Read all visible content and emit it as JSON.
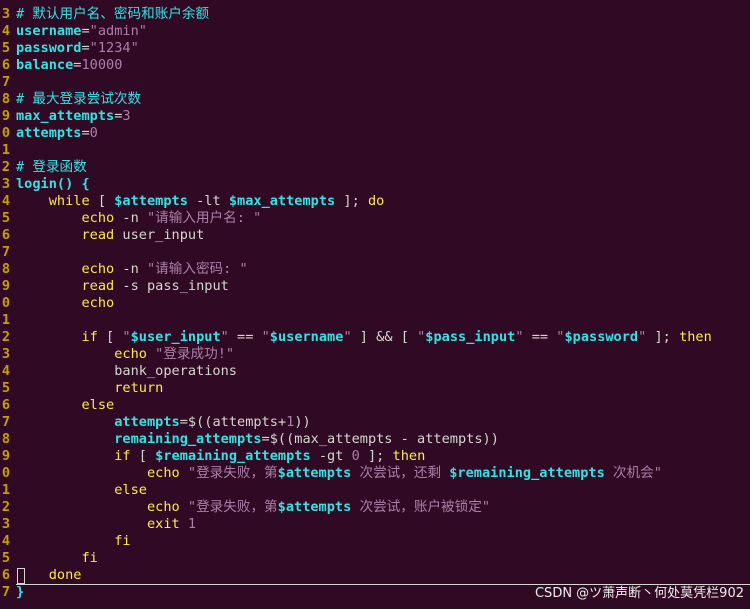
{
  "editor": {
    "lines": [
      {
        "num": "3",
        "parts": [
          {
            "c": "cmt",
            "t": "# 默认用户名、密码和账户余额"
          }
        ]
      },
      {
        "num": "4",
        "parts": [
          {
            "c": "var",
            "t": "username"
          },
          {
            "c": "plain",
            "t": "="
          },
          {
            "c": "str",
            "t": "\"admin\""
          }
        ]
      },
      {
        "num": "5",
        "parts": [
          {
            "c": "var",
            "t": "password"
          },
          {
            "c": "plain",
            "t": "="
          },
          {
            "c": "str",
            "t": "\"1234\""
          }
        ]
      },
      {
        "num": "6",
        "parts": [
          {
            "c": "var",
            "t": "balance"
          },
          {
            "c": "plain",
            "t": "="
          },
          {
            "c": "num",
            "t": "10000"
          }
        ]
      },
      {
        "num": "7",
        "parts": []
      },
      {
        "num": "8",
        "parts": [
          {
            "c": "cmt",
            "t": "# 最大登录尝试次数"
          }
        ]
      },
      {
        "num": "9",
        "parts": [
          {
            "c": "var",
            "t": "max_attempts"
          },
          {
            "c": "plain",
            "t": "="
          },
          {
            "c": "num",
            "t": "3"
          }
        ]
      },
      {
        "num": "0",
        "parts": [
          {
            "c": "var",
            "t": "attempts"
          },
          {
            "c": "plain",
            "t": "="
          },
          {
            "c": "num",
            "t": "0"
          }
        ]
      },
      {
        "num": "1",
        "parts": []
      },
      {
        "num": "2",
        "parts": [
          {
            "c": "cmt",
            "t": "# 登录函数"
          }
        ]
      },
      {
        "num": "3",
        "parts": [
          {
            "c": "fn",
            "t": "login() {"
          }
        ]
      },
      {
        "num": "4",
        "parts": [
          {
            "c": "plain",
            "t": "    "
          },
          {
            "c": "kw",
            "t": "while"
          },
          {
            "c": "plain",
            "t": " [ "
          },
          {
            "c": "var",
            "t": "$attempts"
          },
          {
            "c": "plain",
            "t": " -lt "
          },
          {
            "c": "var",
            "t": "$max_attempts"
          },
          {
            "c": "plain",
            "t": " ]; "
          },
          {
            "c": "kw",
            "t": "do"
          }
        ]
      },
      {
        "num": "5",
        "parts": [
          {
            "c": "plain",
            "t": "        "
          },
          {
            "c": "kw",
            "t": "echo"
          },
          {
            "c": "plain",
            "t": " -n "
          },
          {
            "c": "str",
            "t": "\"请输入用户名: \""
          }
        ]
      },
      {
        "num": "6",
        "parts": [
          {
            "c": "plain",
            "t": "        "
          },
          {
            "c": "kw",
            "t": "read"
          },
          {
            "c": "plain",
            "t": " user_input"
          }
        ]
      },
      {
        "num": "7",
        "parts": []
      },
      {
        "num": "8",
        "parts": [
          {
            "c": "plain",
            "t": "        "
          },
          {
            "c": "kw",
            "t": "echo"
          },
          {
            "c": "plain",
            "t": " -n "
          },
          {
            "c": "str",
            "t": "\"请输入密码: \""
          }
        ]
      },
      {
        "num": "9",
        "parts": [
          {
            "c": "plain",
            "t": "        "
          },
          {
            "c": "kw",
            "t": "read"
          },
          {
            "c": "plain",
            "t": " -s pass_input"
          }
        ]
      },
      {
        "num": "0",
        "parts": [
          {
            "c": "plain",
            "t": "        "
          },
          {
            "c": "kw",
            "t": "echo"
          }
        ]
      },
      {
        "num": "1",
        "parts": []
      },
      {
        "num": "2",
        "parts": [
          {
            "c": "plain",
            "t": "        "
          },
          {
            "c": "kw",
            "t": "if"
          },
          {
            "c": "plain",
            "t": " [ "
          },
          {
            "c": "str",
            "t": "\""
          },
          {
            "c": "var",
            "t": "$user_input"
          },
          {
            "c": "str",
            "t": "\""
          },
          {
            "c": "plain",
            "t": " == "
          },
          {
            "c": "str",
            "t": "\""
          },
          {
            "c": "var",
            "t": "$username"
          },
          {
            "c": "str",
            "t": "\""
          },
          {
            "c": "plain",
            "t": " ] && [ "
          },
          {
            "c": "str",
            "t": "\""
          },
          {
            "c": "var",
            "t": "$pass_input"
          },
          {
            "c": "str",
            "t": "\""
          },
          {
            "c": "plain",
            "t": " == "
          },
          {
            "c": "str",
            "t": "\""
          },
          {
            "c": "var",
            "t": "$password"
          },
          {
            "c": "str",
            "t": "\""
          },
          {
            "c": "plain",
            "t": " ]; "
          },
          {
            "c": "kw",
            "t": "then"
          }
        ]
      },
      {
        "num": "3",
        "parts": [
          {
            "c": "plain",
            "t": "            "
          },
          {
            "c": "kw",
            "t": "echo"
          },
          {
            "c": "plain",
            "t": " "
          },
          {
            "c": "str",
            "t": "\"登录成功!\""
          }
        ]
      },
      {
        "num": "4",
        "parts": [
          {
            "c": "plain",
            "t": "            bank_operations"
          }
        ]
      },
      {
        "num": "5",
        "parts": [
          {
            "c": "plain",
            "t": "            "
          },
          {
            "c": "kw",
            "t": "return"
          }
        ]
      },
      {
        "num": "6",
        "parts": [
          {
            "c": "plain",
            "t": "        "
          },
          {
            "c": "kw",
            "t": "else"
          }
        ]
      },
      {
        "num": "7",
        "parts": [
          {
            "c": "plain",
            "t": "            "
          },
          {
            "c": "var",
            "t": "attempts"
          },
          {
            "c": "plain",
            "t": "=$(("
          },
          {
            "c": "plain",
            "t": "attempts"
          },
          {
            "c": "plain",
            "t": "+"
          },
          {
            "c": "num",
            "t": "1"
          },
          {
            "c": "plain",
            "t": "))"
          }
        ]
      },
      {
        "num": "8",
        "parts": [
          {
            "c": "plain",
            "t": "            "
          },
          {
            "c": "var",
            "t": "remaining_attempts"
          },
          {
            "c": "plain",
            "t": "=$((max_attempts - attempts))"
          }
        ]
      },
      {
        "num": "9",
        "parts": [
          {
            "c": "plain",
            "t": "            "
          },
          {
            "c": "kw",
            "t": "if"
          },
          {
            "c": "plain",
            "t": " [ "
          },
          {
            "c": "var",
            "t": "$remaining_attempts"
          },
          {
            "c": "plain",
            "t": " -gt "
          },
          {
            "c": "num",
            "t": "0"
          },
          {
            "c": "plain",
            "t": " ]; "
          },
          {
            "c": "kw",
            "t": "then"
          }
        ]
      },
      {
        "num": "0",
        "parts": [
          {
            "c": "plain",
            "t": "                "
          },
          {
            "c": "kw",
            "t": "echo"
          },
          {
            "c": "plain",
            "t": " "
          },
          {
            "c": "str",
            "t": "\"登录失败，第"
          },
          {
            "c": "var",
            "t": "$attempts"
          },
          {
            "c": "str",
            "t": " 次尝试，还剩 "
          },
          {
            "c": "var",
            "t": "$remaining_attempts"
          },
          {
            "c": "str",
            "t": " 次机会\""
          }
        ]
      },
      {
        "num": "1",
        "parts": [
          {
            "c": "plain",
            "t": "            "
          },
          {
            "c": "kw",
            "t": "else"
          }
        ]
      },
      {
        "num": "2",
        "parts": [
          {
            "c": "plain",
            "t": "                "
          },
          {
            "c": "kw",
            "t": "echo"
          },
          {
            "c": "plain",
            "t": " "
          },
          {
            "c": "str",
            "t": "\"登录失败，第"
          },
          {
            "c": "var",
            "t": "$attempts"
          },
          {
            "c": "str",
            "t": " 次尝试，账户被锁定\""
          }
        ]
      },
      {
        "num": "3",
        "parts": [
          {
            "c": "plain",
            "t": "                "
          },
          {
            "c": "kw",
            "t": "exit"
          },
          {
            "c": "plain",
            "t": " "
          },
          {
            "c": "num",
            "t": "1"
          }
        ]
      },
      {
        "num": "4",
        "parts": [
          {
            "c": "plain",
            "t": "            "
          },
          {
            "c": "kw",
            "t": "fi"
          }
        ]
      },
      {
        "num": "5",
        "parts": [
          {
            "c": "plain",
            "t": "        "
          },
          {
            "c": "kw",
            "t": "fi"
          }
        ]
      },
      {
        "num": "6",
        "parts": [
          {
            "c": "plain",
            "t": "    "
          },
          {
            "c": "kw",
            "t": "done"
          }
        ]
      },
      {
        "num": "7",
        "parts": [
          {
            "c": "brace",
            "t": "}"
          }
        ]
      }
    ]
  },
  "watermark": {
    "text": "CSDN @ツ萧声断丶何处莫凭栏902"
  },
  "colors": {
    "background": "#300a24",
    "comment": "#34e2e2",
    "keyword": "#fce94f",
    "string": "#ad7fa8",
    "line_number": "#c4a000",
    "plain": "#d3d7cf"
  }
}
